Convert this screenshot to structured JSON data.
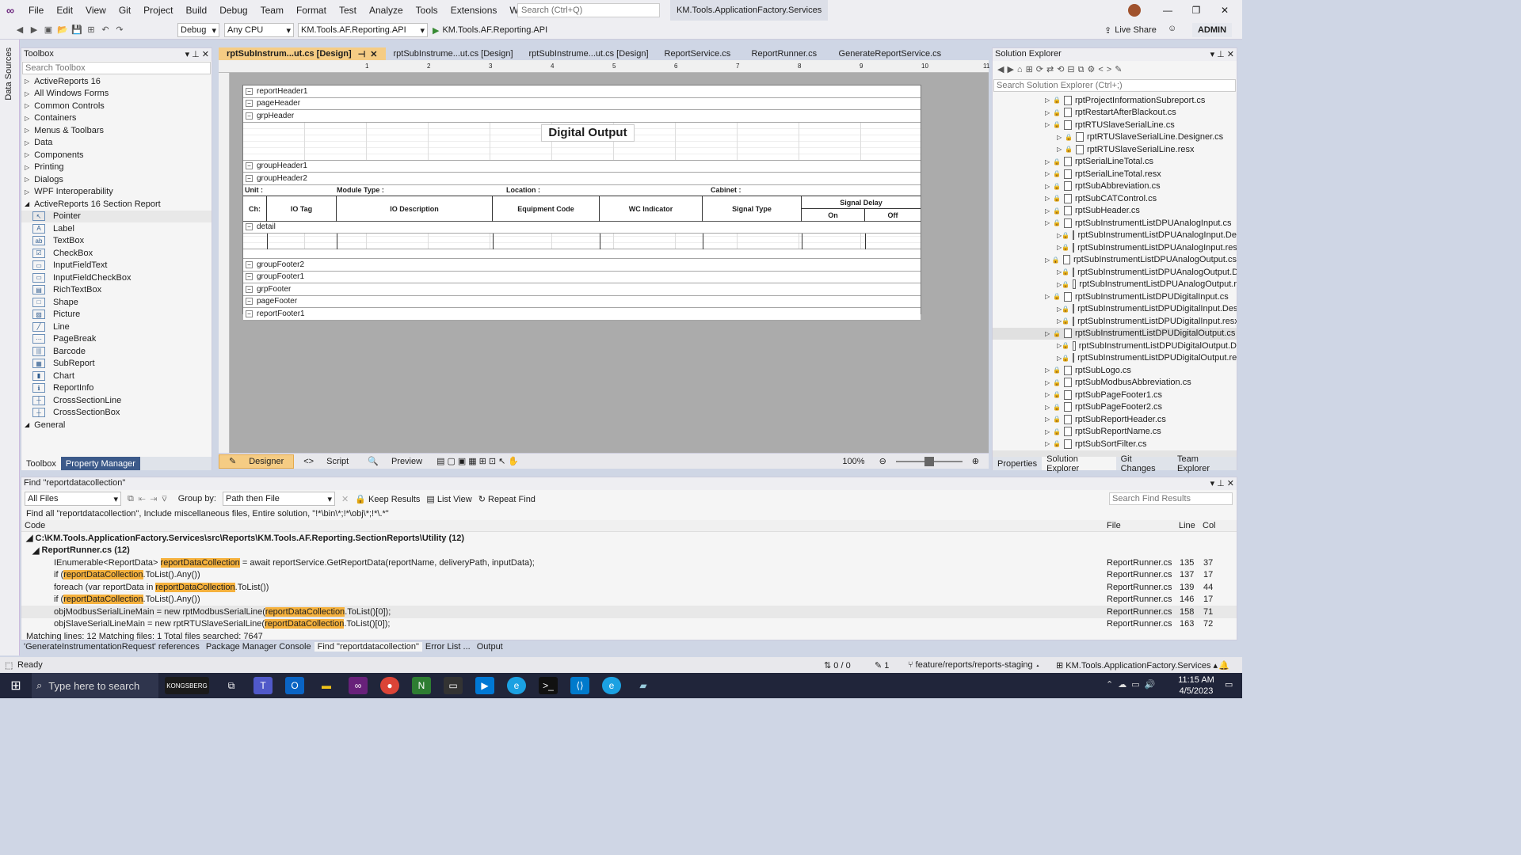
{
  "menus": [
    "File",
    "Edit",
    "View",
    "Git",
    "Project",
    "Build",
    "Debug",
    "Team",
    "Format",
    "Test",
    "Analyze",
    "Tools",
    "Extensions",
    "Window",
    "Help"
  ],
  "search_placeholder": "Search (Ctrl+Q)",
  "solution_title": "KM.Tools.ApplicationFactory.Services",
  "toolbar": {
    "config": "Debug",
    "platform": "Any CPU",
    "startup": "KM.Tools.AF.Reporting.API",
    "run": "KM.Tools.AF.Reporting.API",
    "live_share": "Live Share",
    "admin": "ADMIN"
  },
  "left_strip": "Data Sources",
  "toolbox": {
    "title": "Toolbox",
    "search": "Search Toolbox",
    "groups": [
      "ActiveReports 16",
      "All Windows Forms",
      "Common Controls",
      "Containers",
      "Menus & Toolbars",
      "Data",
      "Components",
      "Printing",
      "Dialogs",
      "WPF Interoperability",
      "ActiveReports 16 Section Report"
    ],
    "items": [
      "Pointer",
      "Label",
      "TextBox",
      "CheckBox",
      "InputFieldText",
      "InputFieldCheckBox",
      "RichTextBox",
      "Shape",
      "Picture",
      "Line",
      "PageBreak",
      "Barcode",
      "SubReport",
      "Chart",
      "ReportInfo",
      "CrossSectionLine",
      "CrossSectionBox"
    ],
    "last_group": "General",
    "tabs": [
      "Toolbox",
      "Property Manager"
    ]
  },
  "doc_tabs": [
    "rptSubInstrum...ut.cs [Design]",
    "rptSubInstrume...ut.cs [Design]",
    "rptSubInstrume...ut.cs [Design]",
    "ReportService.cs",
    "ReportRunner.cs",
    "GenerateReportService.cs"
  ],
  "ruler": [
    "1",
    "2",
    "3",
    "4",
    "5",
    "6",
    "7",
    "8",
    "9",
    "10",
    "11"
  ],
  "report": {
    "bands_top": [
      "reportHeader1",
      "pageHeader",
      "grpHeader"
    ],
    "title": "Digital Output",
    "bands_mid": [
      "groupHeader1",
      "groupHeader2"
    ],
    "unit": "Unit :",
    "module_type": "Module Type :",
    "location": "Location :",
    "cabinet": "Cabinet :",
    "cols": [
      "Ch:",
      "IO Tag",
      "IO Description",
      "Equipment Code",
      "WC Indicator",
      "Signal Type"
    ],
    "signal_delay": "Signal Delay",
    "on": "On",
    "off": "Off",
    "detail": "detail",
    "bands_bottom": [
      "groupFooter2",
      "groupFooter1",
      "grpFooter",
      "pageFooter",
      "reportFooter1"
    ]
  },
  "designer_tabs": {
    "designer": "Designer",
    "script": "Script",
    "preview": "Preview",
    "zoom": "100%"
  },
  "solution_explorer": {
    "title": "Solution Explorer",
    "search": "Search Solution Explorer (Ctrl+;)",
    "items": [
      {
        "t": "rptProjectInformationSubreport.cs",
        "l": 0
      },
      {
        "t": "rptRestartAfterBlackout.cs",
        "l": 0
      },
      {
        "t": "rptRTUSlaveSerialLine.cs",
        "l": 0
      },
      {
        "t": "rptRTUSlaveSerialLine.Designer.cs",
        "l": 1
      },
      {
        "t": "rptRTUSlaveSerialLine.resx",
        "l": 1
      },
      {
        "t": "rptSerialLineTotal.cs",
        "l": 0
      },
      {
        "t": "rptSerialLineTotal.resx",
        "l": 0
      },
      {
        "t": "rptSubAbbreviation.cs",
        "l": 0
      },
      {
        "t": "rptSubCATControl.cs",
        "l": 0
      },
      {
        "t": "rptSubHeader.cs",
        "l": 0
      },
      {
        "t": "rptSubInstrumentListDPUAnalogInput.cs",
        "l": 0
      },
      {
        "t": "rptSubInstrumentListDPUAnalogInput.De",
        "l": 1
      },
      {
        "t": "rptSubInstrumentListDPUAnalogInput.res",
        "l": 1
      },
      {
        "t": "rptSubInstrumentListDPUAnalogOutput.cs",
        "l": 0
      },
      {
        "t": "rptSubInstrumentListDPUAnalogOutput.D",
        "l": 1
      },
      {
        "t": "rptSubInstrumentListDPUAnalogOutput.r",
        "l": 1
      },
      {
        "t": "rptSubInstrumentListDPUDigitalInput.cs",
        "l": 0
      },
      {
        "t": "rptSubInstrumentListDPUDigitalInput.Des",
        "l": 1
      },
      {
        "t": "rptSubInstrumentListDPUDigitalInput.resx",
        "l": 1
      },
      {
        "t": "rptSubInstrumentListDPUDigitalOutput.cs",
        "l": 0
      },
      {
        "t": "rptSubInstrumentListDPUDigitalOutput.D",
        "l": 1
      },
      {
        "t": "rptSubInstrumentListDPUDigitalOutput.re",
        "l": 1
      },
      {
        "t": "rptSubLogo.cs",
        "l": 0
      },
      {
        "t": "rptSubModbusAbbreviation.cs",
        "l": 0
      },
      {
        "t": "rptSubPageFooter1.cs",
        "l": 0
      },
      {
        "t": "rptSubPageFooter2.cs",
        "l": 0
      },
      {
        "t": "rptSubReportHeader.cs",
        "l": 0
      },
      {
        "t": "rptSubReportName.cs",
        "l": 0
      },
      {
        "t": "rptSubSortFilter.cs",
        "l": 0
      }
    ],
    "tabs": [
      "Properties",
      "Solution Explorer",
      "Git Changes",
      "Team Explorer"
    ]
  },
  "find": {
    "title": "Find \"reportdatacollection\"",
    "scope": "All Files",
    "group_by_label": "Group by:",
    "group_by": "Path then File",
    "keep": "Keep Results",
    "list": "List View",
    "repeat": "Repeat Find",
    "search": "Search Find Results",
    "summary": "Find all \"reportdatacollection\", Include miscellaneous files, Entire solution, \"!*\\bin\\*;!*\\obj\\*;!*\\.*\"",
    "headers": {
      "code": "Code",
      "file": "File",
      "line": "Line",
      "col": "Col"
    },
    "path": "C:\\KM.Tools.ApplicationFactory.Services\\src\\Reports\\KM.Tools.AF.Reporting.SectionReports\\Utility (12)",
    "file": "ReportRunner.cs (12)",
    "rows": [
      {
        "pre": "IEnumerable<ReportData> ",
        "hl": "reportDataCollection",
        "post": " = await reportService.GetReportData(reportName, deliveryPath, inputData);",
        "file": "ReportRunner.cs",
        "line": "135",
        "col": "37"
      },
      {
        "pre": "if (",
        "hl": "reportDataCollection",
        "post": ".ToList().Any())",
        "file": "ReportRunner.cs",
        "line": "137",
        "col": "17"
      },
      {
        "pre": "foreach (var reportData in ",
        "hl": "reportDataCollection",
        "post": ".ToList())",
        "file": "ReportRunner.cs",
        "line": "139",
        "col": "44"
      },
      {
        "pre": "if (",
        "hl": "reportDataCollection",
        "post": ".ToList().Any())",
        "file": "ReportRunner.cs",
        "line": "146",
        "col": "17"
      },
      {
        "pre": "objModbusSerialLineMain = new rptModbusSerialLine(",
        "hl": "reportDataCollection",
        "post": ".ToList()[0]);",
        "file": "ReportRunner.cs",
        "line": "158",
        "col": "71"
      },
      {
        "pre": "objSlaveSerialLineMain = new rptRTUSlaveSerialLine(",
        "hl": "reportDataCollection",
        "post": ".ToList()[0]);",
        "file": "ReportRunner.cs",
        "line": "163",
        "col": "72"
      }
    ],
    "footer": "Matching lines: 12 Matching files: 1 Total files searched: 7647"
  },
  "bottom_tabs": [
    "'GenerateInstrumentationRequest' references",
    "Package Manager Console",
    "Find \"reportdatacollection\"",
    "Error List ...",
    "Output"
  ],
  "status": {
    "ready": "Ready",
    "errors": "0 / 0",
    "edits": "1",
    "branch": "feature/reports/reports-staging",
    "project": "KM.Tools.ApplicationFactory.Services"
  },
  "taskbar": {
    "search": "Type here to search",
    "time": "11:15 AM",
    "date": "4/5/2023",
    "kongsberg": "KONGSBERG"
  }
}
